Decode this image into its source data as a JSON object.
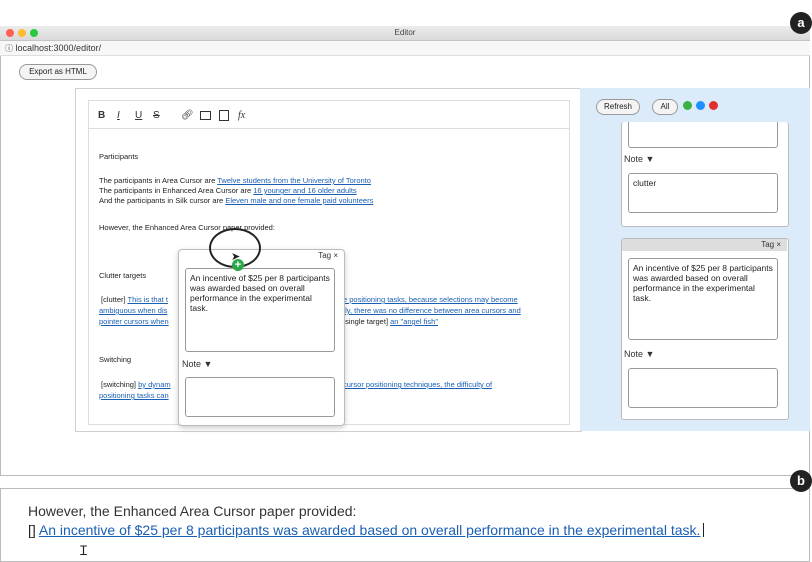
{
  "window": {
    "title": "Editor",
    "url": "localhost:3000/editor/"
  },
  "toolbar": {
    "export_label": "Export as HTML"
  },
  "format": {
    "bold": "B",
    "italic": "I",
    "underline": "U",
    "strike": "S",
    "formula": "fx"
  },
  "doc": {
    "heading1": "Participants",
    "line1_prefix": "The participants in Area Cursor are ",
    "line1_link": "Twelve students from the University of Toronto",
    "line2_prefix": "The participants in Enhanced Area Cursor are ",
    "line2_link": "16 younger and 16 older adults",
    "line3_prefix": "And the participants in Silk cursor are ",
    "line3_link": "Eleven male and one female paid volunteers",
    "line4": "However, the Enhanced Area Cursor paper provided:",
    "heading2": "Clutter targets",
    "clutter_tag": "[clutter]",
    "clutter_link_a": "This is that t",
    "clutter_link_b": "e positioning tasks, because selections may become",
    "clutter_link_c": "ambiguous when dis",
    "clutter_link_d": "tly, there was no difference between area cursors and",
    "clutter_link_e": "pointer cursors when",
    "single_tag": "[single target]",
    "single_link": "an \"angel fish\"",
    "heading3": "Switching",
    "switch_tag": "[switching]",
    "switch_link_a": "by dynam",
    "switch_link_b": "cursor positioning techniques, the difficulty of",
    "switch_link_c": "positioning tasks can"
  },
  "popup": {
    "tag_label": "Tag ×",
    "text": "An incentive of $25 per 8 participants was awarded based on overall performance in the experimental task.",
    "note_label": "Note ▼"
  },
  "sidebar": {
    "refresh_label": "Refresh",
    "all_label": "All",
    "filter_colors": [
      "#3cb043",
      "#1e90ff",
      "#e03030"
    ],
    "note1_label": "Note ▼",
    "note1_value": "clutter",
    "card2_tag_label": "Tag ×",
    "card2_text": "An incentive of $25 per 8 participants was awarded based on overall performance in the experimental task.",
    "note2_label": "Note ▼"
  },
  "panel_b": {
    "line1": "However, the Enhanced Area Cursor paper provided:",
    "prefix": "[]",
    "link": "An incentive of $25 per 8 participants was awarded based on overall performance in the experimental task."
  },
  "labels": {
    "a": "a",
    "b": "b"
  }
}
